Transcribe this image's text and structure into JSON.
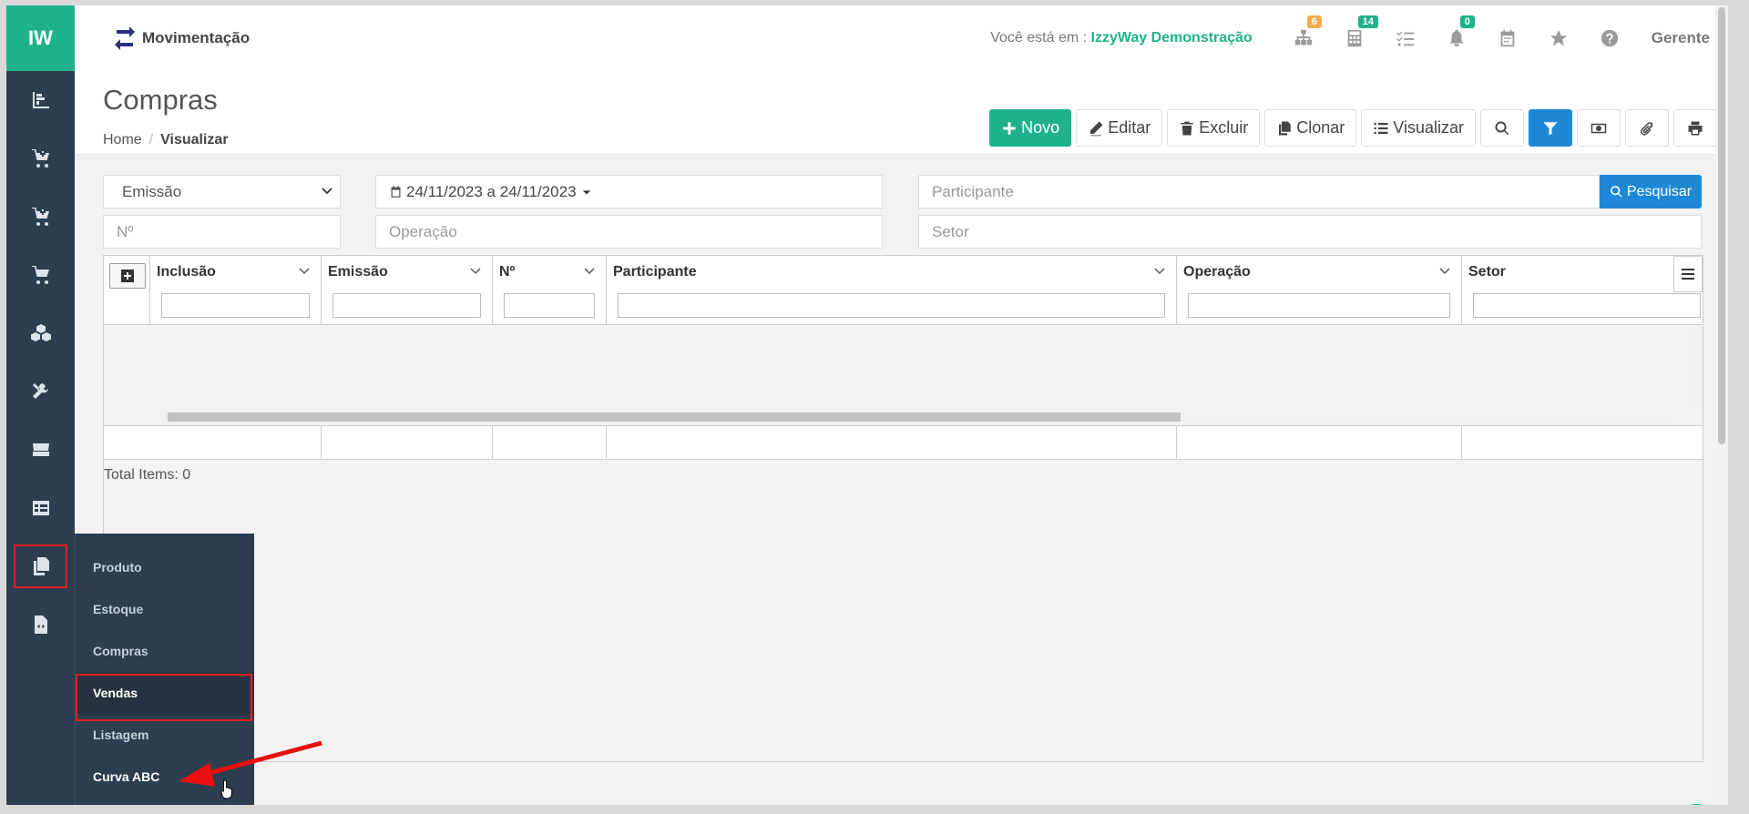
{
  "sidebar": {
    "logo": "IW",
    "icons": [
      "chart-bar-icon",
      "cart-plus-icon",
      "cart-plus-icon",
      "cart-icon",
      "cubes-icon",
      "tools-icon",
      "hdd-icon",
      "table-icon",
      "copy-icon",
      "file-code-icon"
    ]
  },
  "submenu": {
    "items": [
      "Produto",
      "Estoque",
      "Compras",
      "Vendas",
      "Listagem",
      "Curva ABC"
    ]
  },
  "topbar": {
    "module": "Movimentação",
    "where_prefix": "Você está em : ",
    "where_company": "IzzyWay Demonstração",
    "badges": {
      "sitemap": "6",
      "calculator": "14",
      "bell": "0"
    },
    "user": "Gerente"
  },
  "page": {
    "title": "Compras",
    "breadcrumb_home": "Home",
    "breadcrumb_sep": "/",
    "breadcrumb_current": "Visualizar"
  },
  "toolbar": {
    "novo": "Novo",
    "editar": "Editar",
    "excluir": "Excluir",
    "clonar": "Clonar",
    "visualizar": "Visualizar"
  },
  "filters": {
    "date_type": "Emissão",
    "date_range": "24/11/2023 a 24/11/2023",
    "participante_placeholder": "Participante",
    "search_label": "Pesquisar",
    "numero_placeholder": "Nº",
    "operacao_placeholder": "Operação",
    "setor_placeholder": "Setor"
  },
  "grid": {
    "columns": [
      "Inclusão",
      "Emissão",
      "Nº",
      "Participante",
      "Operação",
      "Setor"
    ],
    "total_label": "Total Items: 0"
  },
  "colors": {
    "accent": "#1fb28a",
    "primary": "#1e88d8",
    "sidebar": "#2c3e50",
    "highlight": "#e02020"
  }
}
